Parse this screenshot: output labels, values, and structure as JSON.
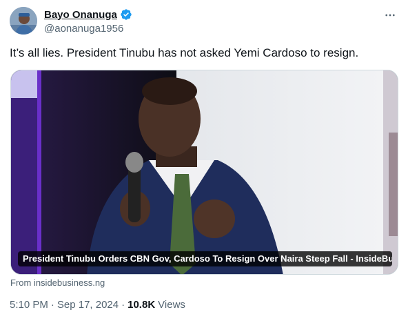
{
  "author": {
    "display_name": "Bayo Onanuga",
    "handle": "@aonanuga1956",
    "verified": true,
    "verified_color": "#1d9bf0"
  },
  "tweet": {
    "text": "It’s all lies. President Tinubu has not asked Yemi Cardoso to resign."
  },
  "card": {
    "title": "President Tinubu Orders CBN Gov, Cardoso To Resign Over Naira Steep Fall - InsideBu...",
    "source": "From insidebusiness.ng"
  },
  "meta": {
    "time": "5:10 PM",
    "separator": "·",
    "date": "Sep 17, 2024",
    "views_count": "10.8K",
    "views_label": "Views"
  },
  "icons": {
    "more": "more-horizontal-icon",
    "verified": "verified-badge-icon"
  }
}
